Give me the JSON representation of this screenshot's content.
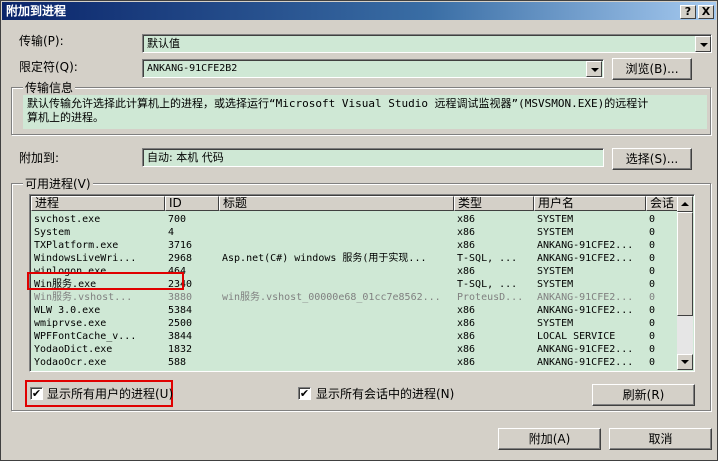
{
  "window": {
    "title": "附加到进程",
    "help_btn": "?",
    "close_btn": "X"
  },
  "transport": {
    "label": "传输(P):",
    "value": "默认值"
  },
  "qualifier": {
    "label": "限定符(Q):",
    "value": "ANKANG-91CFE2B2",
    "browse_btn": "浏览(B)..."
  },
  "transport_info": {
    "title": "传输信息",
    "text_line1": "默认传输允许选择此计算机上的进程，或选择运行“Microsoft Visual Studio 远程调试监视器”(MSVSMON.EXE)的远程计",
    "text_line2": "算机上的进程。"
  },
  "attach_to": {
    "label": "附加到:",
    "value": "自动: 本机 代码",
    "select_btn": "选择(S)..."
  },
  "available": {
    "title": "可用进程(V)",
    "columns": [
      "进程",
      "ID",
      "标题",
      "类型",
      "用户名",
      "会话"
    ],
    "rows": [
      [
        "svchost.exe",
        "700",
        "",
        "x86",
        "SYSTEM",
        "0"
      ],
      [
        "System",
        "4",
        "",
        "x86",
        "SYSTEM",
        "0"
      ],
      [
        "TXPlatform.exe",
        "3716",
        "",
        "x86",
        "ANKANG-91CFE2...",
        "0"
      ],
      [
        "WindowsLiveWri...",
        "2968",
        "Asp.net(C#) windows 服务(用于实现...",
        "T-SQL, ...",
        "ANKANG-91CFE2...",
        "0"
      ],
      [
        "winlogon.exe",
        "464",
        "",
        "x86",
        "SYSTEM",
        "0"
      ],
      [
        "Win服务.exe",
        "2340",
        "",
        "T-SQL, ...",
        "SYSTEM",
        "0"
      ],
      [
        "Win服务.vshost...",
        "3880",
        "win服务.vshost_00000e68_01cc7e8562...",
        "ProteusD...",
        "ANKANG-91CFE2...",
        "0"
      ],
      [
        "WLW 3.0.exe",
        "5384",
        "",
        "x86",
        "ANKANG-91CFE2...",
        "0"
      ],
      [
        "wmiprvse.exe",
        "2500",
        "",
        "x86",
        "SYSTEM",
        "0"
      ],
      [
        "WPFFontCache_v...",
        "3844",
        "",
        "x86",
        "LOCAL SERVICE",
        "0"
      ],
      [
        "YodaoDict.exe",
        "1832",
        "",
        "x86",
        "ANKANG-91CFE2...",
        "0"
      ],
      [
        "YodaoOcr.exe",
        "588",
        "",
        "x86",
        "ANKANG-91CFE2...",
        "0"
      ]
    ],
    "show_all_users": "显示所有用户的进程(U)",
    "show_all_sessions": "显示所有会话中的进程(N)",
    "refresh_btn": "刷新(R)",
    "checkmark": "✔"
  },
  "footer": {
    "attach_btn": "附加(A)",
    "cancel_btn": "取消"
  }
}
